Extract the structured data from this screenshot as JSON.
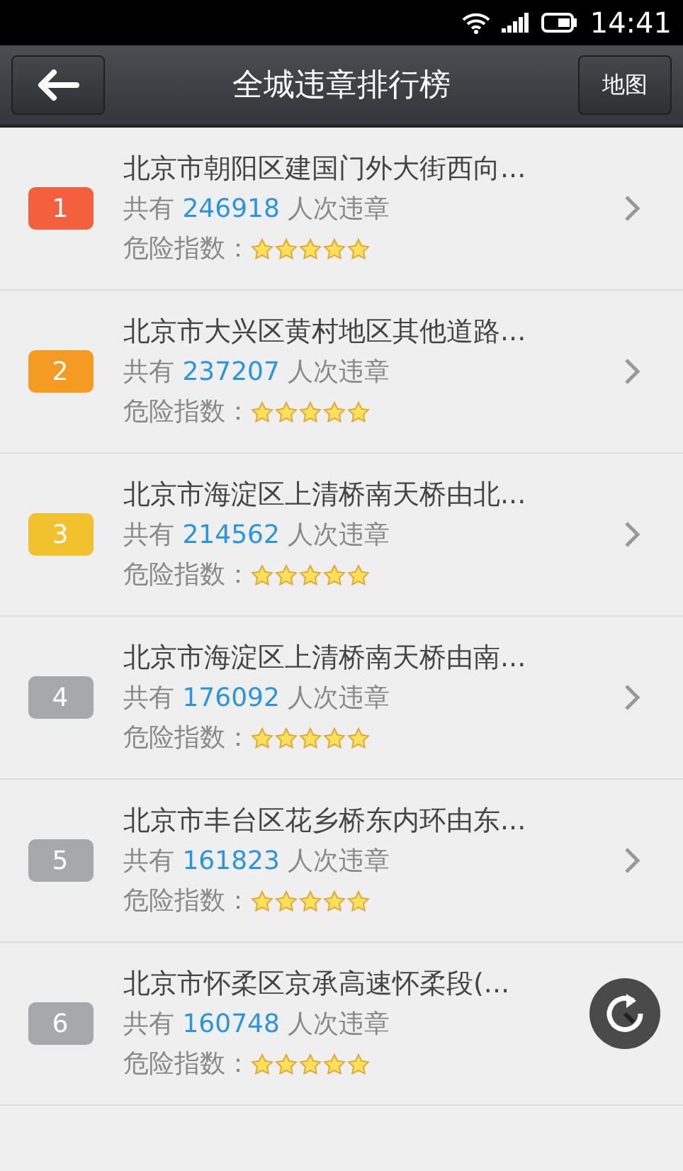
{
  "status_bar": {
    "time": "14:41"
  },
  "header": {
    "title": "全城违章排行榜",
    "map_button": "地图"
  },
  "rows": [
    {
      "rank": "1",
      "color": "#f4603e",
      "address": "北京市朝阳区建国门外大街西向...",
      "prefix": "共有",
      "count": "246918",
      "suffix": "人次违章",
      "danger_label": "危险指数：",
      "stars": 5,
      "chevron": true
    },
    {
      "rank": "2",
      "color": "#f59a23",
      "address": "北京市大兴区黄村地区其他道路...",
      "prefix": "共有",
      "count": "237207",
      "suffix": "人次违章",
      "danger_label": "危险指数：",
      "stars": 5,
      "chevron": true
    },
    {
      "rank": "3",
      "color": "#f2c12e",
      "address": "北京市海淀区上清桥南天桥由北...",
      "prefix": "共有",
      "count": "214562",
      "suffix": "人次违章",
      "danger_label": "危险指数：",
      "stars": 5,
      "chevron": true
    },
    {
      "rank": "4",
      "color": "#a6a8ab",
      "address": "北京市海淀区上清桥南天桥由南...",
      "prefix": "共有",
      "count": "176092",
      "suffix": "人次违章",
      "danger_label": "危险指数：",
      "stars": 5,
      "chevron": true
    },
    {
      "rank": "5",
      "color": "#a6a8ab",
      "address": "北京市丰台区花乡桥东内环由东...",
      "prefix": "共有",
      "count": "161823",
      "suffix": "人次违章",
      "danger_label": "危险指数：",
      "stars": 5,
      "chevron": true
    },
    {
      "rank": "6",
      "color": "#a6a8ab",
      "address": "北京市怀柔区京承高速怀柔段(...",
      "prefix": "共有",
      "count": "160748",
      "suffix": "人次违章",
      "danger_label": "危险指数：",
      "stars": 5,
      "chevron": false
    }
  ]
}
